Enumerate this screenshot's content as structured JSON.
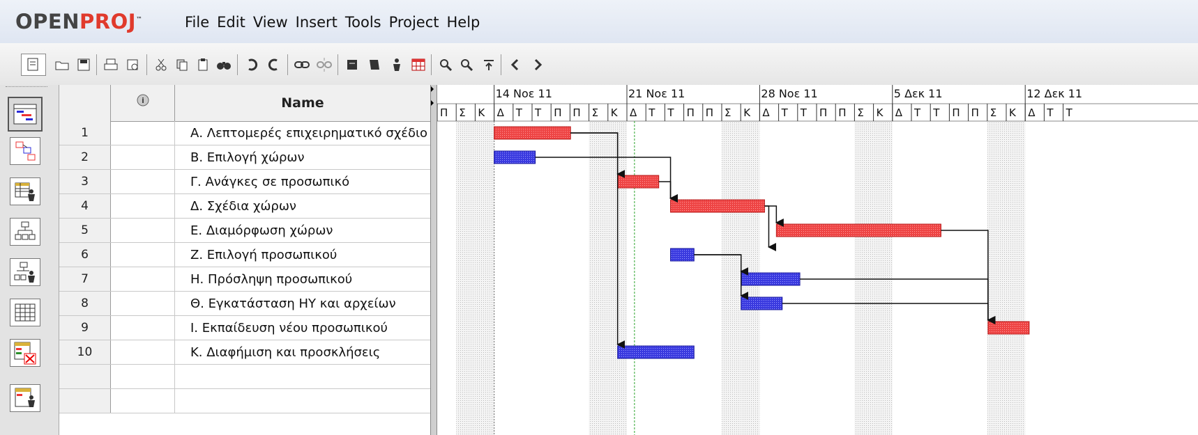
{
  "app": {
    "logo_open": "OPEN",
    "logo_proj": "PROJ",
    "logo_tm": "™"
  },
  "menu": [
    "File",
    "Edit",
    "View",
    "Insert",
    "Tools",
    "Project",
    "Help"
  ],
  "toolbar_icons": [
    "new-icon",
    "open-icon",
    "save-icon",
    "print-icon",
    "print-preview-icon",
    "cut-icon",
    "copy-icon",
    "paste-icon",
    "find-icon",
    "undo-icon",
    "redo-icon",
    "link-icon",
    "unlink-icon",
    "task-info-icon",
    "notes-icon",
    "assign-resources-icon",
    "calendar-icon",
    "zoom-in-icon",
    "zoom-out-icon",
    "filter-icon",
    "scroll-left-icon",
    "scroll-right-icon"
  ],
  "views": [
    "gantt-view-icon",
    "network-view-icon",
    "resource-view-icon",
    "wbs-view-icon",
    "rbs-view-icon",
    "report-view-icon",
    "delete-view-icon",
    "resource-usage-icon"
  ],
  "grid": {
    "header_name": "Name",
    "info_icon": "info-icon",
    "rows": [
      {
        "num": "1",
        "name": "Α. Λεπτομερές επιχειρηματικό σχέδιο"
      },
      {
        "num": "2",
        "name": "Β. Επιλογή χώρων"
      },
      {
        "num": "3",
        "name": "Γ. Ανάγκες σε προσωπικό"
      },
      {
        "num": "4",
        "name": "Δ. Σχέδια χώρων"
      },
      {
        "num": "5",
        "name": "Ε. Διαμόρφωση χώρων"
      },
      {
        "num": "6",
        "name": "Ζ. Επιλογή προσωπικού"
      },
      {
        "num": "7",
        "name": "Η. Πρόσληψη προσωπικού"
      },
      {
        "num": "8",
        "name": "Θ. Εγκατάσταση ΗΥ και αρχείων"
      },
      {
        "num": "9",
        "name": "Ι. Εκπαίδευση νέου προσωπικού"
      },
      {
        "num": "10",
        "name": "Κ. Διαφήμιση και προσκλήσεις"
      }
    ]
  },
  "timescale": {
    "weeks": [
      "14 Νοε 11",
      "21 Νοε 11",
      "28 Νοε 11",
      "5 Δεκ 11",
      "12 Δεκ 11"
    ],
    "days": [
      "Π",
      "Σ",
      "Κ",
      "Δ",
      "Τ",
      "Τ",
      "Π",
      "Π",
      "Σ",
      "Κ",
      "Δ",
      "Τ",
      "Τ",
      "Π",
      "Π",
      "Σ",
      "Κ",
      "Δ",
      "Τ",
      "Τ",
      "Π",
      "Π",
      "Σ",
      "Κ",
      "Δ",
      "Τ",
      "Τ",
      "Π",
      "Π",
      "Σ",
      "Κ",
      "Δ",
      "Τ",
      "Τ"
    ]
  },
  "tasks": [
    {
      "start": 0,
      "duration": 6.5,
      "critical": true
    },
    {
      "start": 0,
      "duration": 3.5,
      "critical": false
    },
    {
      "start": 10.5,
      "duration": 3.5,
      "critical": true
    },
    {
      "start": 15,
      "duration": 8,
      "critical": true
    },
    {
      "start": 24,
      "duration": 14,
      "critical": true
    },
    {
      "start": 15,
      "duration": 2,
      "critical": false
    },
    {
      "start": 21,
      "duration": 5,
      "critical": false
    },
    {
      "start": 21,
      "duration": 3.5,
      "critical": false
    },
    {
      "start": 42,
      "duration": 3.5,
      "critical": true
    },
    {
      "start": 10.5,
      "duration": 6.5,
      "critical": false
    }
  ],
  "dependencies": [
    [
      1,
      3
    ],
    [
      2,
      4
    ],
    [
      3,
      4
    ],
    [
      4,
      5
    ],
    [
      4,
      6
    ],
    [
      6,
      7
    ],
    [
      6,
      8
    ],
    [
      5,
      9
    ],
    [
      7,
      9
    ],
    [
      8,
      9
    ],
    [
      1,
      10
    ]
  ],
  "colors": {
    "critical": "#ee4444",
    "normal": "#3a3adf",
    "critical_border": "#b71c1c",
    "normal_border": "#1a1a9c",
    "arrow": "#111111",
    "weekend": "#e9e9e9"
  }
}
